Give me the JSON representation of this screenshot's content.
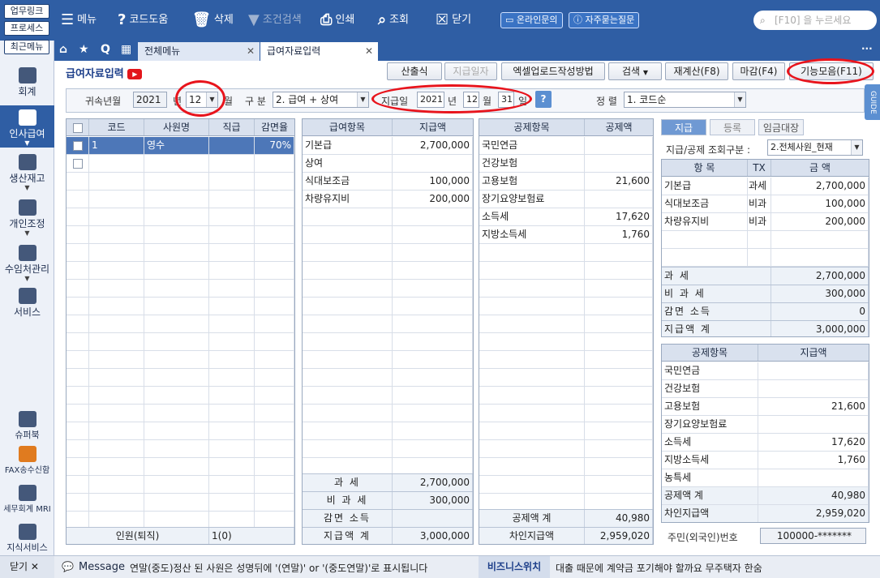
{
  "top": {
    "quick": [
      "업무링크",
      "프로세스",
      "최근메뉴"
    ],
    "menu_label": "메뉴",
    "code_help": "코드도움",
    "delete": "삭제",
    "cond_search": "조건검색",
    "print": "인쇄",
    "lookup": "조회",
    "close": "닫기",
    "online_inquiry": "온라인문의",
    "faq": "자주묻는질문",
    "search_placeholder": "[F10] 을 누르세요"
  },
  "sidebar": {
    "items": [
      "회계",
      "인사급여",
      "생산재고",
      "개인조정",
      "수임처관리",
      "서비스"
    ],
    "lower": [
      "슈퍼북",
      "FAX송수신함",
      "세무회계 MRI",
      "지식서비스"
    ],
    "close_label": "닫기"
  },
  "tabs": [
    "전체메뉴",
    "급여자료입력"
  ],
  "page": {
    "title": "급여자료입력",
    "buttons": [
      "산출식",
      "지급일자",
      "엑셀업로드작성방법",
      "검색",
      "재계산(F8)",
      "마감(F4)",
      "기능모음(F11)"
    ],
    "guide": "GUIDE"
  },
  "filter": {
    "belong_label": "귀속년월",
    "year": "2021",
    "year_unit": "년",
    "month": "12",
    "month_unit": "월",
    "type_label": "구 분",
    "type_value": "2. 급여 + 상여",
    "pay_date_label": "지급일",
    "pay_year": "2021",
    "pay_month": "12",
    "pay_day": "31",
    "day_unit": "일",
    "sort_label": "정 렬",
    "sort_value": "1. 코드순"
  },
  "employees": {
    "headers": [
      "코드",
      "사원명",
      "직급",
      "감면율"
    ],
    "rows": [
      {
        "code": "1",
        "name": "영수",
        "rank": "",
        "rate": "70%"
      }
    ],
    "footer_label": "인원(퇴직)",
    "footer_value": "1(0)"
  },
  "pay_items": {
    "headers": [
      "급여항목",
      "지급액"
    ],
    "rows": [
      {
        "item": "기본급",
        "amount": "2,700,000"
      },
      {
        "item": "상여",
        "amount": ""
      },
      {
        "item": "식대보조금",
        "amount": "100,000"
      },
      {
        "item": "차량유지비",
        "amount": "200,000"
      }
    ],
    "summary": [
      {
        "label": "과 세",
        "value": "2,700,000"
      },
      {
        "label": "비 과 세",
        "value": "300,000"
      },
      {
        "label": "감면 소득",
        "value": ""
      },
      {
        "label": "지급액 계",
        "value": "3,000,000"
      }
    ]
  },
  "deduction_items": {
    "headers": [
      "공제항목",
      "공제액"
    ],
    "rows": [
      {
        "item": "국민연금",
        "amount": ""
      },
      {
        "item": "건강보험",
        "amount": ""
      },
      {
        "item": "고용보험",
        "amount": "21,600"
      },
      {
        "item": "장기요양보험료",
        "amount": ""
      },
      {
        "item": "소득세",
        "amount": "17,620"
      },
      {
        "item": "지방소득세",
        "amount": "1,760"
      }
    ],
    "summary": [
      {
        "label": "공제액 계",
        "value": "40,980"
      },
      {
        "label": "차인지급액",
        "value": "2,959,020"
      }
    ]
  },
  "right": {
    "tabs": [
      "지급",
      "등록",
      "임금대장"
    ],
    "view_label": "지급/공제 조회구분 :",
    "view_value": "2.전체사원_현재",
    "pay_headers": [
      "항 목",
      "TX",
      "금 액"
    ],
    "pay_rows": [
      {
        "item": "기본급",
        "tx": "과세",
        "amount": "2,700,000"
      },
      {
        "item": "식대보조금",
        "tx": "비과",
        "amount": "100,000"
      },
      {
        "item": "차량유지비",
        "tx": "비과",
        "amount": "200,000"
      }
    ],
    "pay_summary": [
      {
        "label": "과 세",
        "value": "2,700,000"
      },
      {
        "label": "비 과 세",
        "value": "300,000"
      },
      {
        "label": "감면 소득",
        "value": "0"
      },
      {
        "label": "지급액 계",
        "value": "3,000,000"
      }
    ],
    "ded_headers": [
      "공제항목",
      "지급액"
    ],
    "ded_rows": [
      {
        "item": "국민연금",
        "amount": ""
      },
      {
        "item": "건강보험",
        "amount": ""
      },
      {
        "item": "고용보험",
        "amount": "21,600"
      },
      {
        "item": "장기요양보험료",
        "amount": ""
      },
      {
        "item": "소득세",
        "amount": "17,620"
      },
      {
        "item": "지방소득세",
        "amount": "1,760"
      },
      {
        "item": "농특세",
        "amount": ""
      },
      {
        "item": "공제액 계",
        "amount": "40,980"
      },
      {
        "item": "차인지급액",
        "amount": "2,959,020"
      }
    ],
    "resident_label": "주민(외국인)번호",
    "resident_value": "100000-*******"
  },
  "bottom": {
    "message_label": "Message",
    "message": "연말(중도)정산 된 사원은 성명뒤에 '(연말)' or '(중도연말)'로 표시됩니다",
    "news_label": "비즈니스위치",
    "news": "대출 때문에 계약금 포기해야 할까요 무주택자 한숨"
  }
}
